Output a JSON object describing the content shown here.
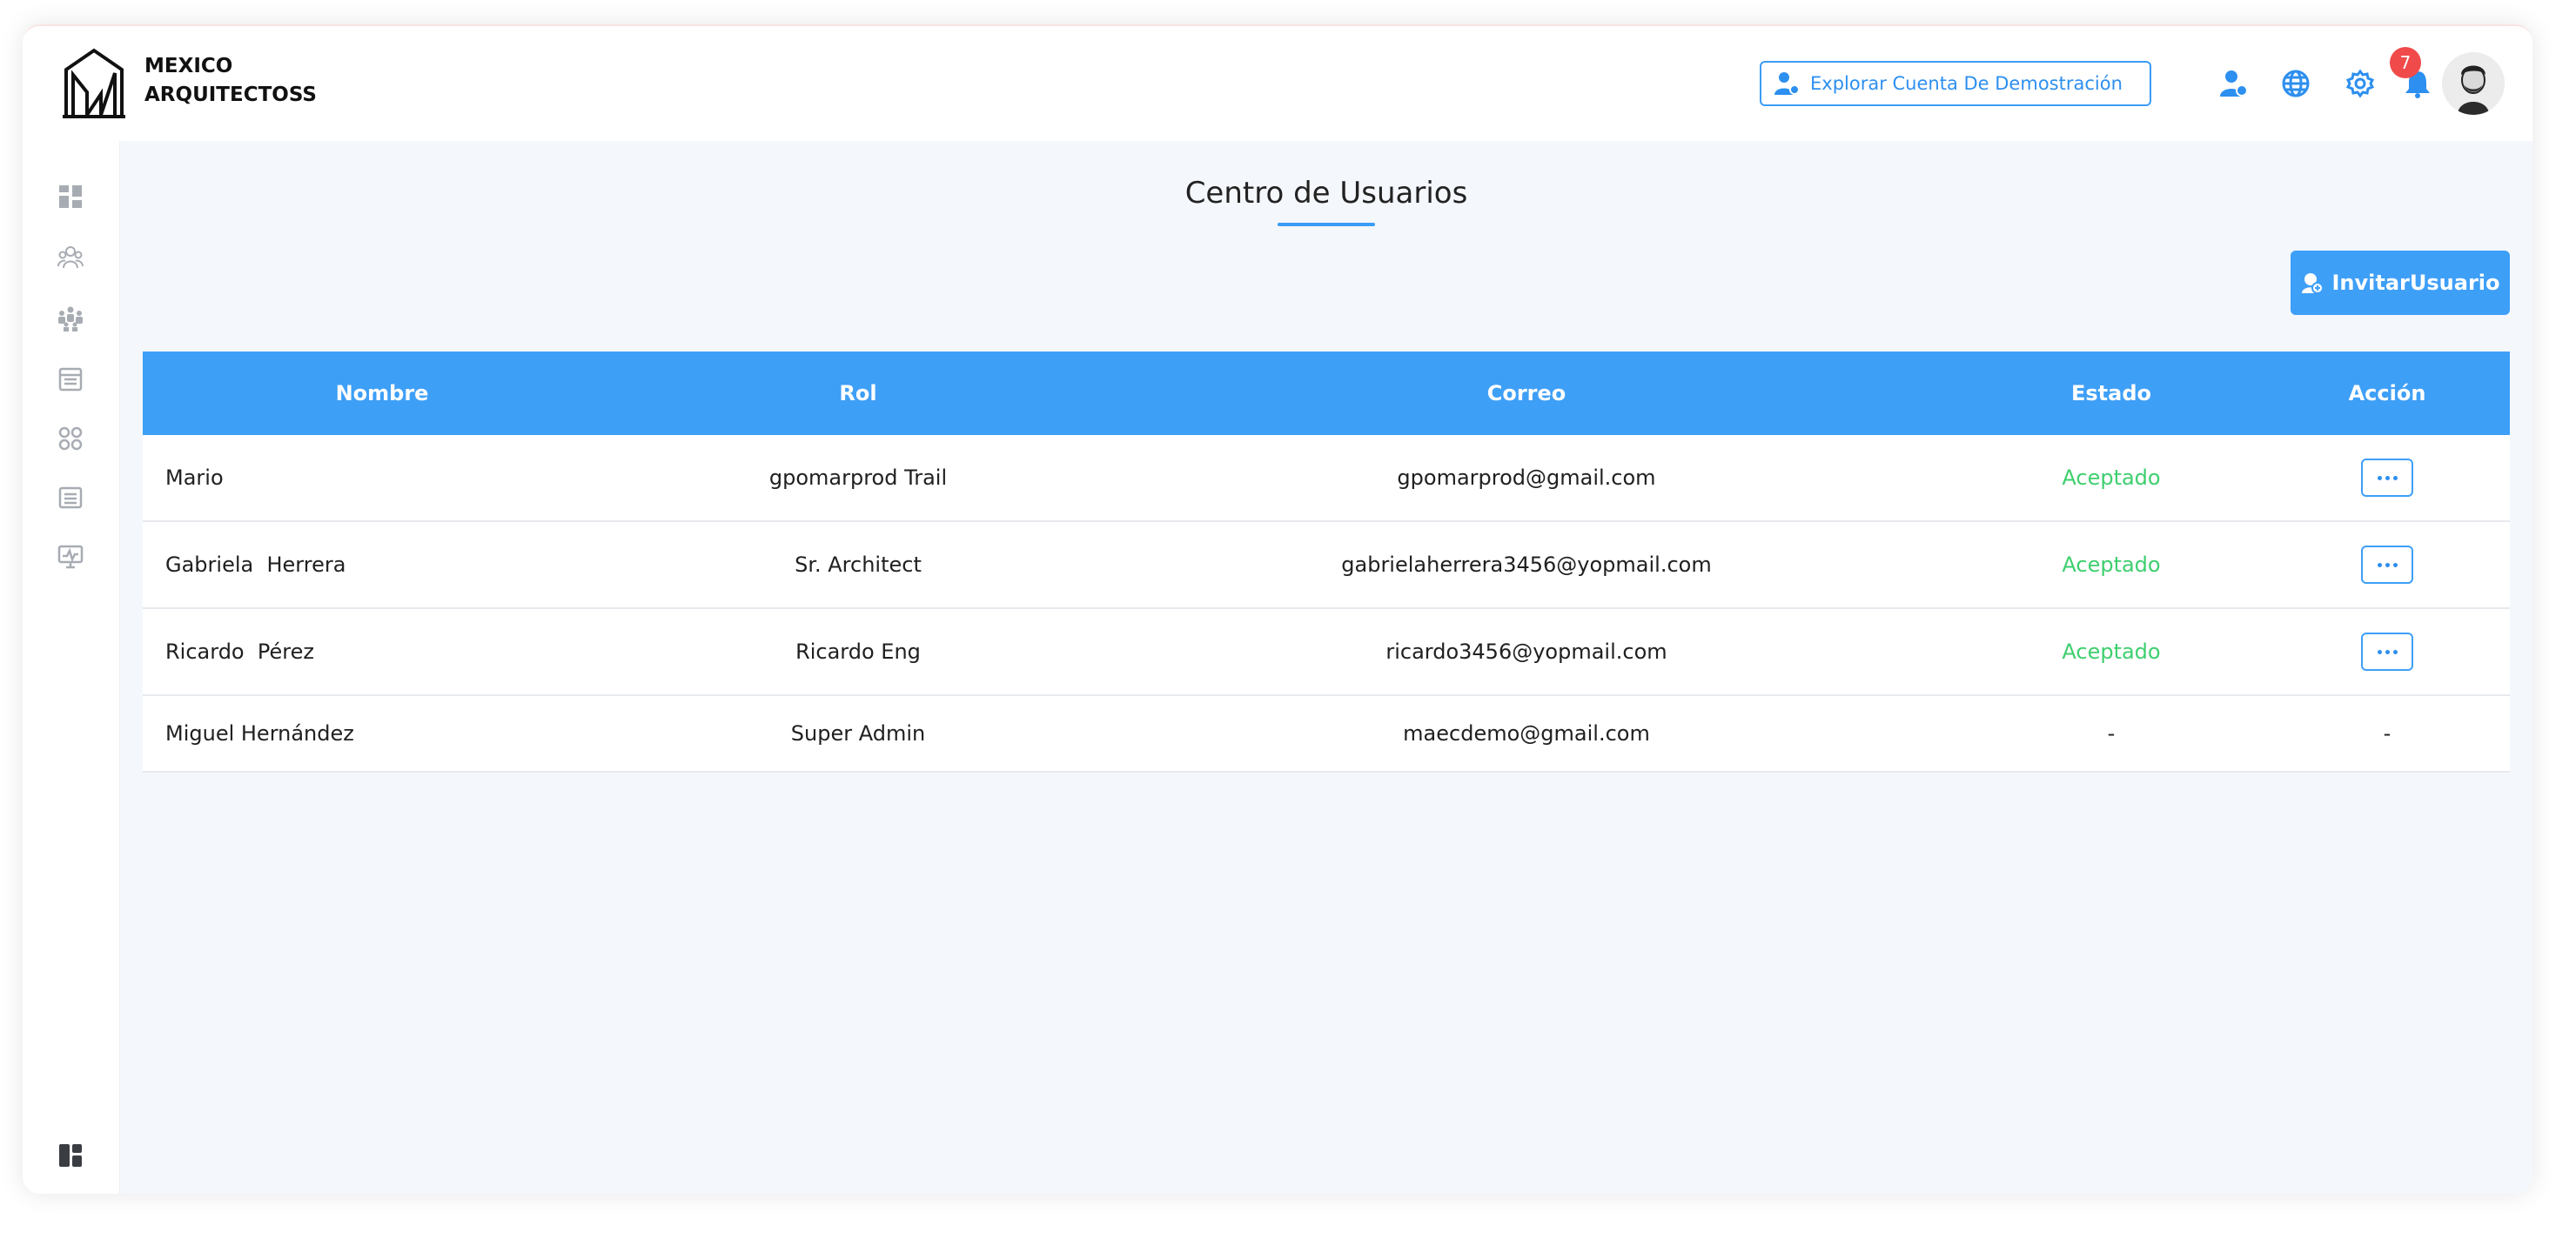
{
  "brand": {
    "line1": "MEXICO",
    "line2": "ARQUITECTOSS"
  },
  "header": {
    "demo_label": "Explorar Cuenta De Demostración",
    "notification_count": "7",
    "icons": [
      "user-plus-icon",
      "globe-icon",
      "gear-icon",
      "bell-icon"
    ]
  },
  "sidebar": {
    "items": [
      "dashboard-icon",
      "team-icon",
      "users-icon",
      "calendar-icon",
      "modules-icon",
      "list-icon",
      "monitor-icon"
    ],
    "footer": "layout-icon"
  },
  "page": {
    "title": "Centro de Usuarios",
    "invite_label": "InvitarUsuario"
  },
  "table": {
    "headers": [
      "Nombre",
      "Rol",
      "Correo",
      "Estado",
      "Acción"
    ],
    "rows": [
      {
        "name": "Mario",
        "role": "gpomarprod Trail",
        "email": "gpomarprod@gmail.com",
        "status": "Aceptado",
        "action": "more"
      },
      {
        "name": "Gabriela  Herrera",
        "role": "Sr. Architect",
        "email": "gabrielaherrera3456@yopmail.com",
        "status": "Aceptado",
        "action": "more"
      },
      {
        "name": "Ricardo  Pérez",
        "role": "Ricardo Eng",
        "email": "ricardo3456@yopmail.com",
        "status": "Aceptado",
        "action": "more"
      },
      {
        "name": "Miguel Hernández",
        "role": "Super Admin",
        "email": "maecdemo@gmail.com",
        "status": "-",
        "action": "-"
      }
    ]
  },
  "colors": {
    "accent": "#3e9ff7",
    "success": "#3ecf6e",
    "badge": "#f04a4a",
    "chat": "#1f7bd8"
  }
}
